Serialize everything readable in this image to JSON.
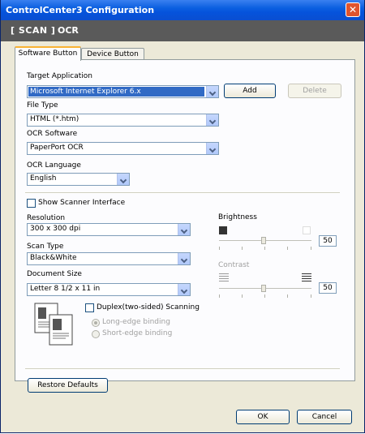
{
  "window": {
    "title": "ControlCenter3 Configuration",
    "close_glyph": "✕"
  },
  "header": {
    "scan": "[  SCAN  ]",
    "ocr": "OCR"
  },
  "tabs": [
    {
      "label": "Software Button"
    },
    {
      "label": "Device Button"
    }
  ],
  "target_application": {
    "label": "Target Application",
    "value": "Microsoft Internet Explorer 6.x",
    "add": "Add",
    "delete": "Delete"
  },
  "file_type": {
    "label": "File Type",
    "value": "HTML (*.htm)"
  },
  "ocr_software": {
    "label": "OCR Software",
    "value": "PaperPort OCR"
  },
  "ocr_language": {
    "label": "OCR Language",
    "value": "English"
  },
  "show_scanner_interface": {
    "label": "Show Scanner Interface",
    "checked": false
  },
  "resolution": {
    "label": "Resolution",
    "value": "300 x 300 dpi"
  },
  "scan_type": {
    "label": "Scan Type",
    "value": "Black&White"
  },
  "document_size": {
    "label": "Document Size",
    "value": "Letter 8 1/2 x 11 in"
  },
  "brightness": {
    "label": "Brightness",
    "value": "50"
  },
  "contrast": {
    "label": "Contrast",
    "value": "50"
  },
  "duplex": {
    "label": "Duplex(two-sided) Scanning",
    "checked": false,
    "long_edge": "Long-edge binding",
    "short_edge": "Short-edge binding"
  },
  "restore_defaults": "Restore Defaults",
  "footer": {
    "ok": "OK",
    "cancel": "Cancel"
  },
  "colors": {
    "title_bar": "#0553dc",
    "header_bar": "#5a5a5a",
    "dialog_bg": "#ece9d8",
    "selection": "#316ac5"
  },
  "icons": {
    "close": "close-icon",
    "duplex_document": "duplex-document-icon"
  }
}
